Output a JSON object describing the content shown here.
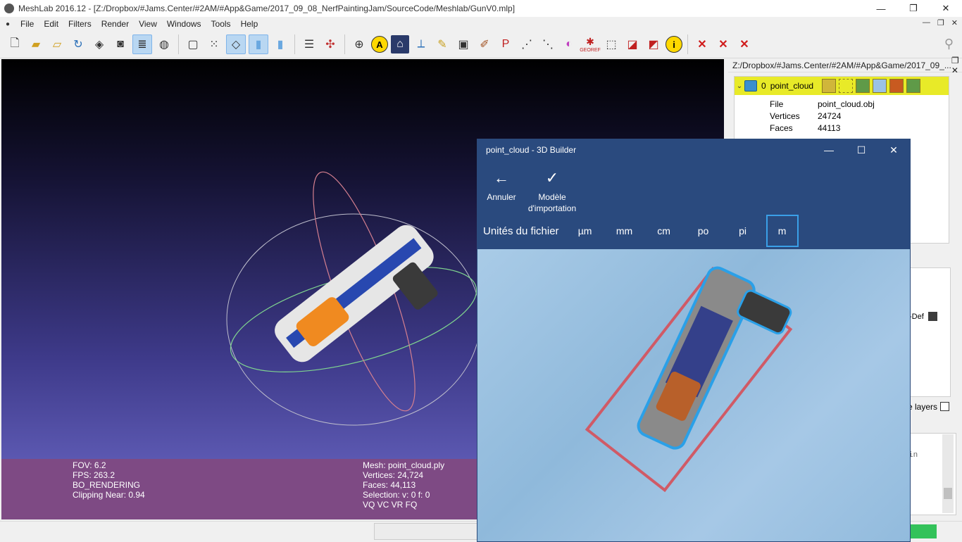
{
  "window": {
    "title": "MeshLab 2016.12 - [Z:/Dropbox/#Jams.Center/#2AM/#App&Game/2017_09_08_NerfPaintingJam/SourceCode/Meshlab/GunV0.mlp]",
    "minimize": "—",
    "restore": "❐",
    "close": "✕"
  },
  "menu": {
    "items": [
      "File",
      "Edit",
      "Filters",
      "Render",
      "View",
      "Windows",
      "Tools",
      "Help"
    ],
    "mdi_controls": [
      "—",
      "❐",
      "✕"
    ]
  },
  "toolbar": {
    "icons": [
      "new-icon",
      "open-icon",
      "open-project-icon",
      "reload-icon",
      "save-icon",
      "snapshot-icon",
      "layers-icon",
      "sphere-icon",
      "bbox-icon",
      "points-icon",
      "wireframe-icon",
      "flat-icon",
      "smooth-icon",
      "light-icon",
      "axis-icon",
      "trackball-icon",
      "annotation-icon",
      "house-icon",
      "measure-icon",
      "paint-icon",
      "camera-icon",
      "brush-icon",
      "pickpoints-icon",
      "select-icon",
      "align-icon",
      "quality-icon",
      "georef-icon",
      "vertex-select-icon",
      "face-select-icon",
      "connected-select-icon",
      "info-icon",
      "delete-faces-icon",
      "delete-vertices-icon",
      "delete-all-icon",
      "search-icon"
    ],
    "annotation_glyph": "A",
    "info_glyph": "i",
    "georef_label": "GEOREF"
  },
  "viewport": {
    "info_left": [
      "FOV: 6.2",
      "FPS:   263.2",
      "BO_RENDERING",
      "Clipping Near:   0.94"
    ],
    "info_right": [
      "Mesh: point_cloud.ply",
      "Vertices: 24,724",
      "Faces: 44,113",
      "Selection: v: 0 f: 0",
      "VQ VC VR FQ"
    ],
    "gradient_top": "#000000",
    "gradient_bottom": "#6d6ac8",
    "infobar_color": "#7e4a84"
  },
  "layer_panel": {
    "title": "Z:/Dropbox/#Jams.Center/#2AM/#App&Game/2017_09_...",
    "layer": {
      "index": "0",
      "name": "point_cloud"
    },
    "props": [
      {
        "key": "File",
        "value": "point_cloud.obj"
      },
      {
        "key": "Vertices",
        "value": "24724"
      },
      {
        "key": "Faces",
        "value": "44113"
      }
    ],
    "partial_def": "-Def",
    "partial_layers": "e layers",
    "log_text": "in"
  },
  "dialog": {
    "title": "point_cloud - 3D Builder",
    "back_label": "Annuler",
    "import_label_1": "Modèle",
    "import_label_2": "d'importation",
    "units_label": "Unités du fichier",
    "units": [
      "µm",
      "mm",
      "cm",
      "po",
      "pi",
      "m"
    ],
    "selected_unit": "m",
    "header_color": "#2a4a7e",
    "accent": "#3aa0e8"
  }
}
